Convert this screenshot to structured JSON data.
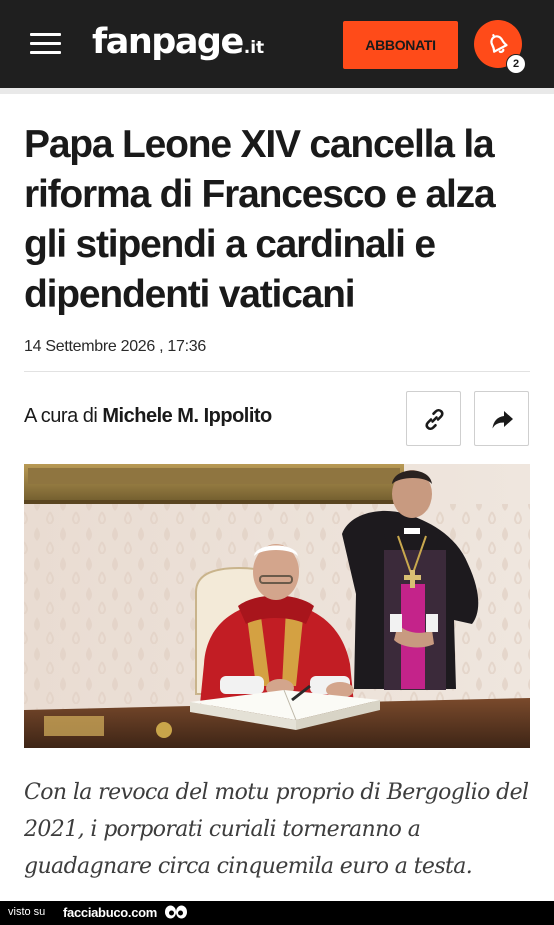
{
  "header": {
    "menu_icon": "hamburger-menu-icon",
    "logo_text": "fanpage",
    "logo_tld": ".it",
    "subscribe_label": "ABBONATI",
    "notification_icon": "bell-icon",
    "notification_count": "2",
    "bar_color": "#1f1f1f",
    "accent_color": "#ff4b19"
  },
  "article": {
    "headline": "Papa Leone XIV cancella la riforma di Francesco e alza gli stipendi a cardinali e dipendenti vaticani",
    "date": "14 Settembre 2026 , 17:36",
    "author_prefix": "A cura di",
    "author_name": "Michele M. Ippolito",
    "copy_link_icon": "link-icon",
    "share_icon": "share-arrow-icon",
    "caption": "Con la revoca del motu proprio di Bergoglio del 2021, i porporati curiali torneranno a guadagnare circa cinquemila euro a testa."
  },
  "footer": {
    "visto_su": "visto su",
    "site": "facciabuco.com",
    "logo_icon": "eyes-icon"
  }
}
